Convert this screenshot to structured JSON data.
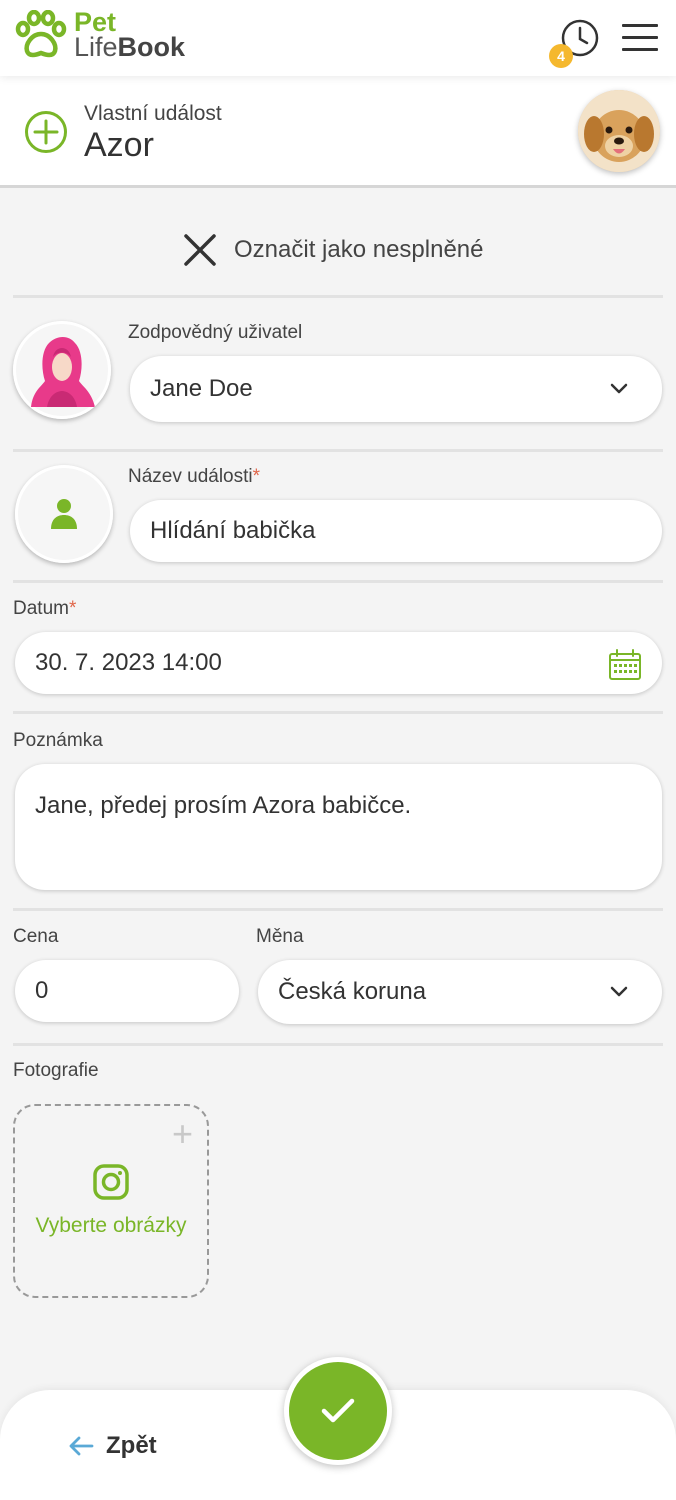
{
  "app": {
    "logo_pet": "Pet",
    "logo_life": "Life",
    "logo_book": "Book",
    "brand_color": "#7ab628",
    "history_badge": "4",
    "history_icon": "clock-icon",
    "menu_icon": "hamburger-icon"
  },
  "event": {
    "type_label": "Vlastní událost",
    "pet_name": "Azor",
    "type_icon": "plus-circle-icon"
  },
  "status_toggle": {
    "label": "Označit jako nesplněné",
    "icon": "close-icon"
  },
  "responsible_user": {
    "label": "Zodpovědný uživatel",
    "value": "Jane Doe"
  },
  "event_name": {
    "label": "Název události",
    "required_mark": "*",
    "value": "Hlídání babička"
  },
  "date": {
    "label": "Datum",
    "required_mark": "*",
    "value": "30. 7. 2023 14:00"
  },
  "note": {
    "label": "Poznámka",
    "value": "Jane, předej prosím Azora babičce."
  },
  "price": {
    "label": "Cena",
    "value": "0"
  },
  "currency": {
    "label": "Měna",
    "value": "Česká koruna"
  },
  "photos": {
    "label": "Fotografie",
    "button_label": "Vyberte obrázky",
    "plus": "+"
  },
  "footer": {
    "back_label": "Zpět",
    "confirm_icon": "checkmark-icon"
  }
}
